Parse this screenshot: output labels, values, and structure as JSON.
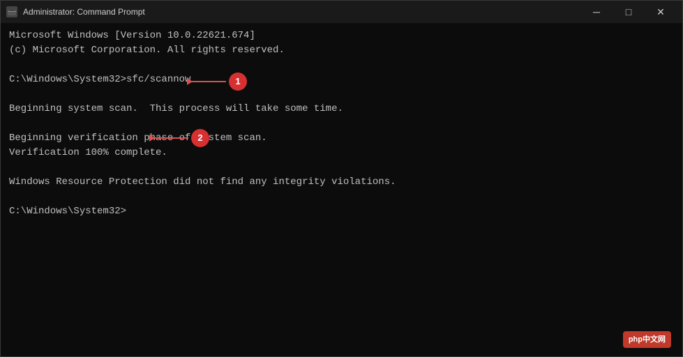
{
  "titleBar": {
    "icon": "C:\\",
    "title": "Administrator: Command Prompt",
    "minimizeLabel": "─",
    "maximizeLabel": "□",
    "closeLabel": "✕"
  },
  "terminal": {
    "lines": [
      "Microsoft Windows [Version 10.0.22621.674]",
      "(c) Microsoft Corporation. All rights reserved.",
      "",
      "C:\\Windows\\System32>sfc/scannow",
      "",
      "Beginning system scan.  This process will take some time.",
      "",
      "Beginning verification phase of system scan.",
      "Verification 100% complete.",
      "",
      "Windows Resource Protection did not find any integrity violations.",
      "",
      "C:\\Windows\\System32>"
    ]
  },
  "callouts": [
    {
      "id": "1",
      "label": "1"
    },
    {
      "id": "2",
      "label": "2"
    }
  ],
  "watermark": {
    "text": "php中文网"
  }
}
